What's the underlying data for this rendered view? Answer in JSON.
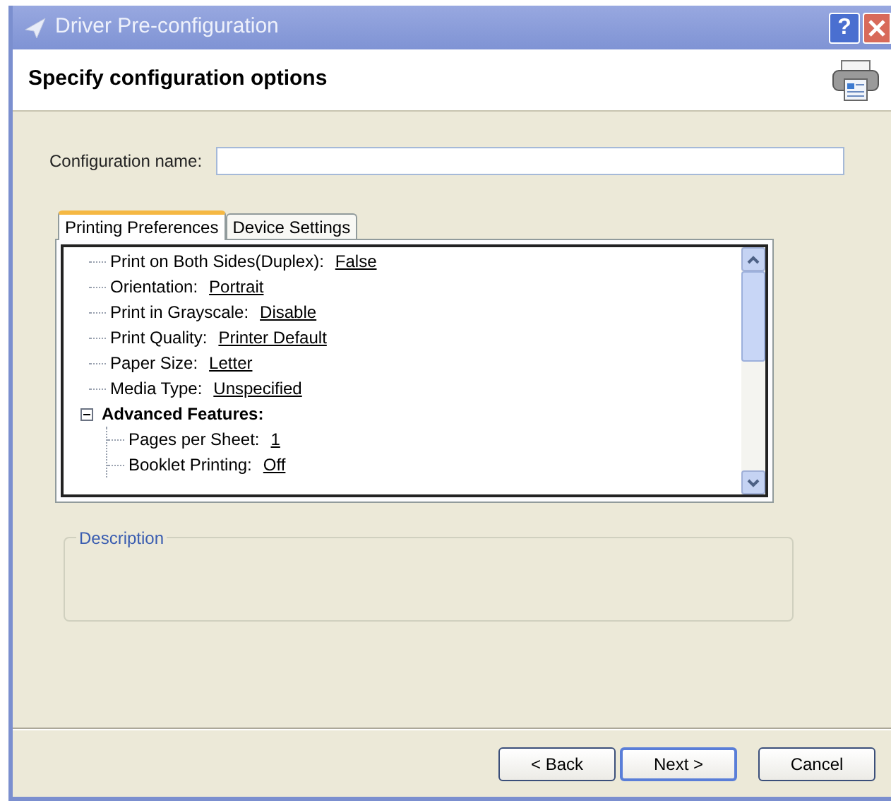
{
  "window": {
    "title": "Driver Pre-configuration",
    "help_button": "?"
  },
  "header": {
    "title": "Specify configuration options"
  },
  "config_name": {
    "label": "Configuration name:"
  },
  "tabs": [
    {
      "label": "Printing Preferences",
      "selected": true
    },
    {
      "label": "Device Settings",
      "selected": false
    }
  ],
  "tree": [
    {
      "kind": "setting",
      "label": "Print on Both Sides(Duplex):",
      "value": "False"
    },
    {
      "kind": "setting",
      "label": "Orientation:",
      "value": "Portrait"
    },
    {
      "kind": "setting",
      "label": "Print in Grayscale:",
      "value": "Disable"
    },
    {
      "kind": "setting",
      "label": "Print Quality:",
      "value": "Printer Default"
    },
    {
      "kind": "setting",
      "label": "Paper Size:",
      "value": "Letter"
    },
    {
      "kind": "setting",
      "label": "Media Type:",
      "value": "Unspecified"
    },
    {
      "kind": "group",
      "label": "Advanced Features:",
      "expanded": true,
      "children": [
        {
          "kind": "setting",
          "label": "Pages per Sheet:",
          "value": "1"
        },
        {
          "kind": "setting",
          "label": "Booklet Printing:",
          "value": "Off"
        }
      ]
    }
  ],
  "description": {
    "label": "Description"
  },
  "buttons": [
    {
      "label": "< Back",
      "default": false
    },
    {
      "label": "Next >",
      "default": true
    },
    {
      "label": "Cancel",
      "default": false
    }
  ]
}
